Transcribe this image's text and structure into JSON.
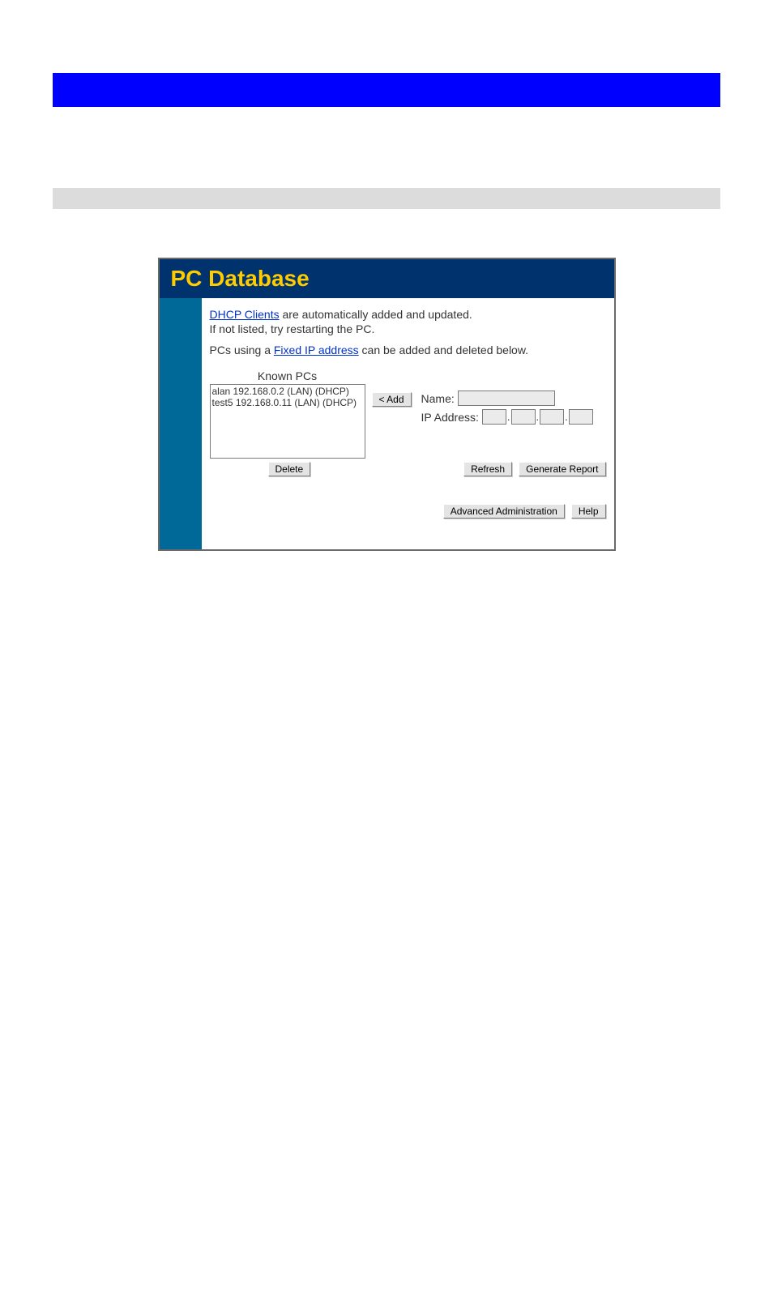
{
  "header": {
    "title": "PC Database"
  },
  "intro": {
    "link1": "DHCP Clients",
    "after_link1": " are automatically added and updated.",
    "line2": "If not listed, try restarting the PC.",
    "before_link2": "PCs using a ",
    "link2": "Fixed IP address",
    "after_link2": " can be added and deleted below."
  },
  "known": {
    "label": "Known PCs",
    "items": [
      "alan 192.168.0.2 (LAN) (DHCP)",
      "test5 192.168.0.11 (LAN) (DHCP)"
    ]
  },
  "buttons": {
    "add": "< Add",
    "delete": "Delete",
    "refresh": "Refresh",
    "generate_report": "Generate Report",
    "advanced": "Advanced Administration",
    "help": "Help"
  },
  "fields": {
    "name_label": "Name:",
    "ip_label": "IP Address:",
    "name_value": "",
    "ip1": "",
    "ip2": "",
    "ip3": "",
    "ip4": ""
  }
}
